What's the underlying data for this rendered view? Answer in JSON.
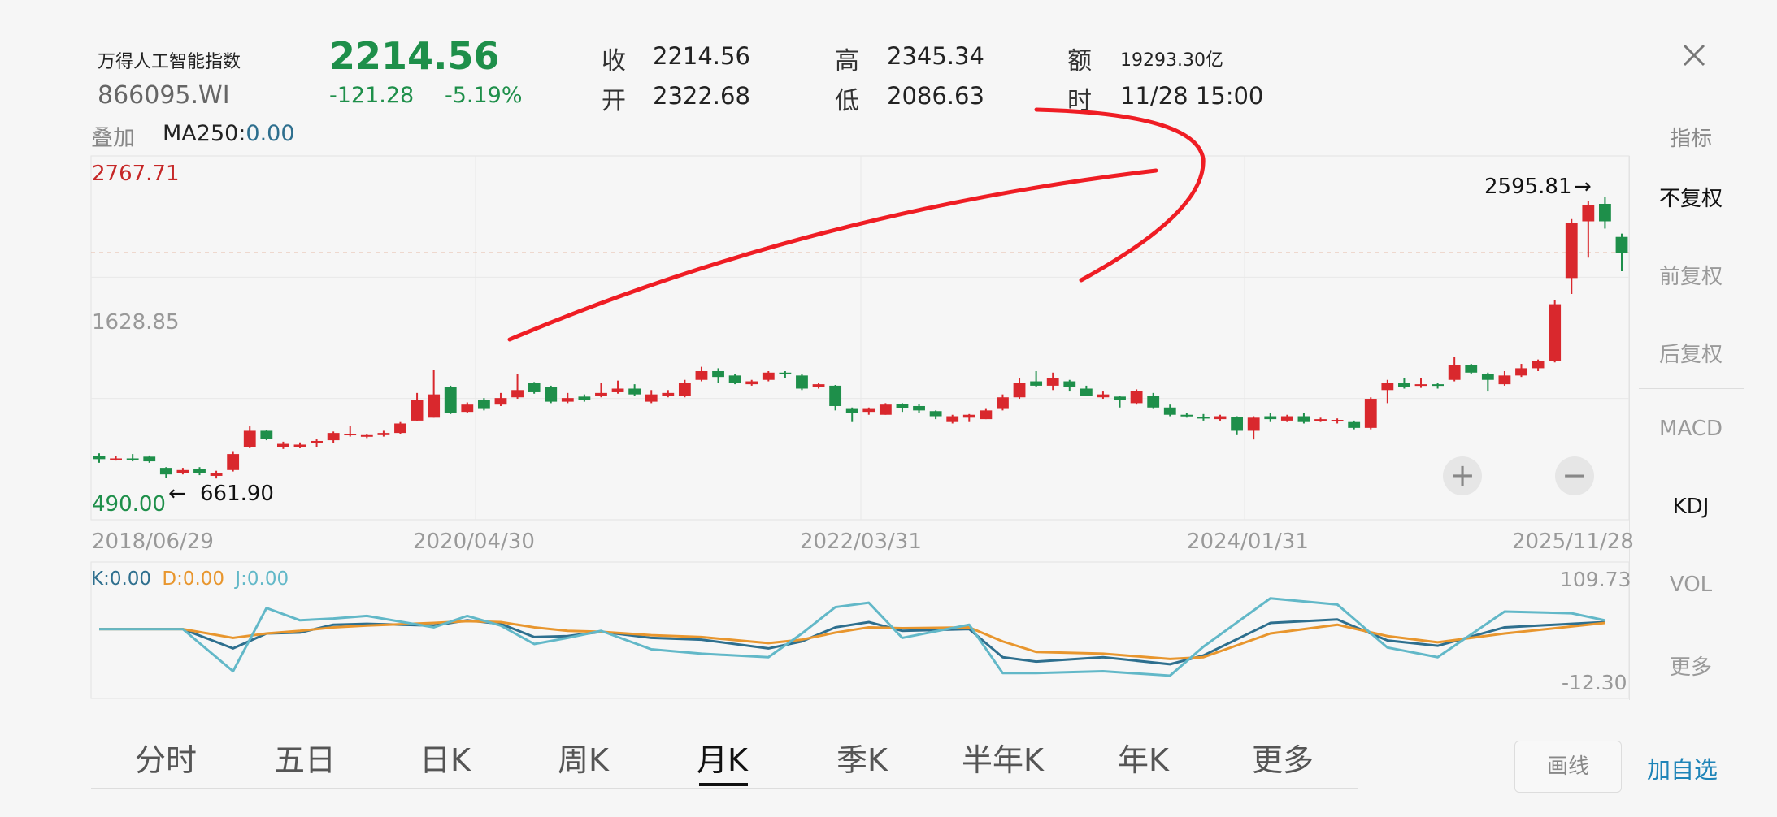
{
  "header": {
    "name": "万得人工智能指数",
    "code": "866095.WI",
    "price": "2214.56",
    "change": "-121.28",
    "change_pct": "-5.19%",
    "close_label": "收",
    "close_value": "2214.56",
    "open_label": "开",
    "open_value": "2322.68",
    "high_label": "高",
    "high_value": "2345.34",
    "low_label": "低",
    "low_value": "2086.63",
    "amount_label": "额",
    "amount_value": "19293.30亿",
    "time_label": "时",
    "time_value": "11/28 15:00",
    "close_icon": "close-icon"
  },
  "overlay": {
    "label": "叠加",
    "ma_label": "MA250:",
    "ma_value": "0.00"
  },
  "sidebar": {
    "title": "指标",
    "items": [
      "不复权",
      "前复权",
      "后复权",
      "MACD",
      "KDJ",
      "VOL",
      "更多"
    ]
  },
  "tabs": [
    "分时",
    "五日",
    "日K",
    "周K",
    "月K",
    "季K",
    "半年K",
    "年K",
    "更多"
  ],
  "active_tab": "月K",
  "bottom_buttons": {
    "draw": "画线",
    "add_watch": "加自选"
  },
  "colors": {
    "up": "#d9282d",
    "down": "#1e8f4a",
    "k": "#2e6f8e",
    "d": "#e8962e",
    "j": "#62b8c8"
  },
  "chart_data": [
    {
      "type": "candlestick",
      "title": "月K",
      "ylim": [
        490.0,
        2767.71
      ],
      "y_labels": {
        "top": "2767.71",
        "mid": "1628.85",
        "bottom": "490.00"
      },
      "x_labels": [
        "2018/06/29",
        "2020/04/30",
        "2022/03/31",
        "2024/01/31",
        "2025/11/28"
      ],
      "annotations": {
        "max_label": "2595.81",
        "min_label": "661.90",
        "max_arrow": "→",
        "min_arrow": "←"
      },
      "candles": [
        {
          "o": 815,
          "c": 795,
          "h": 835,
          "l": 770
        },
        {
          "o": 795,
          "c": 800,
          "h": 815,
          "l": 785
        },
        {
          "o": 800,
          "c": 798,
          "h": 830,
          "l": 780
        },
        {
          "o": 812,
          "c": 780,
          "h": 820,
          "l": 770
        },
        {
          "o": 735,
          "c": 690,
          "h": 740,
          "l": 665
        },
        {
          "o": 700,
          "c": 720,
          "h": 735,
          "l": 690
        },
        {
          "o": 730,
          "c": 700,
          "h": 740,
          "l": 685
        },
        {
          "o": 680,
          "c": 700,
          "h": 715,
          "l": 662
        },
        {
          "o": 720,
          "c": 830,
          "h": 850,
          "l": 710
        },
        {
          "o": 880,
          "c": 990,
          "h": 1020,
          "l": 870
        },
        {
          "o": 990,
          "c": 935,
          "h": 995,
          "l": 925
        },
        {
          "o": 880,
          "c": 900,
          "h": 915,
          "l": 865
        },
        {
          "o": 880,
          "c": 895,
          "h": 910,
          "l": 870
        },
        {
          "o": 905,
          "c": 920,
          "h": 935,
          "l": 880
        },
        {
          "o": 925,
          "c": 975,
          "h": 985,
          "l": 905
        },
        {
          "o": 960,
          "c": 970,
          "h": 1025,
          "l": 950
        },
        {
          "o": 950,
          "c": 960,
          "h": 970,
          "l": 940
        },
        {
          "o": 960,
          "c": 975,
          "h": 990,
          "l": 950
        },
        {
          "o": 975,
          "c": 1040,
          "h": 1050,
          "l": 965
        },
        {
          "o": 1060,
          "c": 1200,
          "h": 1250,
          "l": 1055
        },
        {
          "o": 1080,
          "c": 1240,
          "h": 1410,
          "l": 1080
        },
        {
          "o": 1290,
          "c": 1110,
          "h": 1300,
          "l": 1105
        },
        {
          "o": 1120,
          "c": 1170,
          "h": 1185,
          "l": 1110
        },
        {
          "o": 1200,
          "c": 1140,
          "h": 1215,
          "l": 1130
        },
        {
          "o": 1170,
          "c": 1215,
          "h": 1250,
          "l": 1160
        },
        {
          "o": 1220,
          "c": 1270,
          "h": 1380,
          "l": 1210
        },
        {
          "o": 1320,
          "c": 1255,
          "h": 1325,
          "l": 1245
        },
        {
          "o": 1290,
          "c": 1190,
          "h": 1300,
          "l": 1180
        },
        {
          "o": 1190,
          "c": 1215,
          "h": 1250,
          "l": 1180
        },
        {
          "o": 1225,
          "c": 1200,
          "h": 1240,
          "l": 1190
        },
        {
          "o": 1230,
          "c": 1250,
          "h": 1320,
          "l": 1220
        },
        {
          "o": 1255,
          "c": 1280,
          "h": 1335,
          "l": 1245
        },
        {
          "o": 1280,
          "c": 1240,
          "h": 1310,
          "l": 1230
        },
        {
          "o": 1190,
          "c": 1240,
          "h": 1270,
          "l": 1180
        },
        {
          "o": 1230,
          "c": 1250,
          "h": 1270,
          "l": 1220
        },
        {
          "o": 1230,
          "c": 1320,
          "h": 1340,
          "l": 1220
        },
        {
          "o": 1340,
          "c": 1400,
          "h": 1430,
          "l": 1330
        },
        {
          "o": 1400,
          "c": 1360,
          "h": 1420,
          "l": 1320
        },
        {
          "o": 1370,
          "c": 1320,
          "h": 1380,
          "l": 1310
        },
        {
          "o": 1310,
          "c": 1330,
          "h": 1340,
          "l": 1300
        },
        {
          "o": 1340,
          "c": 1390,
          "h": 1400,
          "l": 1330
        },
        {
          "o": 1390,
          "c": 1380,
          "h": 1400,
          "l": 1350
        },
        {
          "o": 1370,
          "c": 1280,
          "h": 1380,
          "l": 1270
        },
        {
          "o": 1290,
          "c": 1310,
          "h": 1320,
          "l": 1280
        },
        {
          "o": 1300,
          "c": 1160,
          "h": 1305,
          "l": 1130
        },
        {
          "o": 1140,
          "c": 1110,
          "h": 1150,
          "l": 1050
        },
        {
          "o": 1120,
          "c": 1140,
          "h": 1150,
          "l": 1100
        },
        {
          "o": 1100,
          "c": 1170,
          "h": 1180,
          "l": 1100
        },
        {
          "o": 1175,
          "c": 1145,
          "h": 1180,
          "l": 1120
        },
        {
          "o": 1160,
          "c": 1130,
          "h": 1175,
          "l": 1110
        },
        {
          "o": 1125,
          "c": 1090,
          "h": 1130,
          "l": 1070
        },
        {
          "o": 1050,
          "c": 1090,
          "h": 1100,
          "l": 1040
        },
        {
          "o": 1080,
          "c": 1100,
          "h": 1105,
          "l": 1050
        },
        {
          "o": 1070,
          "c": 1130,
          "h": 1140,
          "l": 1070
        },
        {
          "o": 1140,
          "c": 1220,
          "h": 1240,
          "l": 1130
        },
        {
          "o": 1220,
          "c": 1320,
          "h": 1350,
          "l": 1210
        },
        {
          "o": 1330,
          "c": 1300,
          "h": 1400,
          "l": 1290
        },
        {
          "o": 1300,
          "c": 1350,
          "h": 1390,
          "l": 1270
        },
        {
          "o": 1330,
          "c": 1290,
          "h": 1340,
          "l": 1260
        },
        {
          "o": 1280,
          "c": 1230,
          "h": 1300,
          "l": 1230
        },
        {
          "o": 1220,
          "c": 1240,
          "h": 1260,
          "l": 1210
        },
        {
          "o": 1225,
          "c": 1200,
          "h": 1230,
          "l": 1150
        },
        {
          "o": 1180,
          "c": 1265,
          "h": 1275,
          "l": 1170
        },
        {
          "o": 1230,
          "c": 1150,
          "h": 1250,
          "l": 1140
        },
        {
          "o": 1150,
          "c": 1100,
          "h": 1170,
          "l": 1090
        },
        {
          "o": 1100,
          "c": 1090,
          "h": 1110,
          "l": 1080
        },
        {
          "o": 1085,
          "c": 1080,
          "h": 1105,
          "l": 1060
        },
        {
          "o": 1070,
          "c": 1090,
          "h": 1100,
          "l": 1060
        },
        {
          "o": 1085,
          "c": 990,
          "h": 1090,
          "l": 960
        },
        {
          "o": 990,
          "c": 1080,
          "h": 1090,
          "l": 930
        },
        {
          "o": 1090,
          "c": 1070,
          "h": 1110,
          "l": 1050
        },
        {
          "o": 1060,
          "c": 1090,
          "h": 1100,
          "l": 1050
        },
        {
          "o": 1090,
          "c": 1050,
          "h": 1110,
          "l": 1040
        },
        {
          "o": 1060,
          "c": 1070,
          "h": 1080,
          "l": 1050
        },
        {
          "o": 1060,
          "c": 1065,
          "h": 1075,
          "l": 1040
        },
        {
          "o": 1050,
          "c": 1010,
          "h": 1060,
          "l": 1000
        },
        {
          "o": 1010,
          "c": 1210,
          "h": 1220,
          "l": 1000
        },
        {
          "o": 1270,
          "c": 1320,
          "h": 1340,
          "l": 1180
        },
        {
          "o": 1320,
          "c": 1290,
          "h": 1350,
          "l": 1280
        },
        {
          "o": 1300,
          "c": 1310,
          "h": 1350,
          "l": 1285
        },
        {
          "o": 1310,
          "c": 1300,
          "h": 1320,
          "l": 1280
        },
        {
          "o": 1340,
          "c": 1440,
          "h": 1500,
          "l": 1330
        },
        {
          "o": 1440,
          "c": 1390,
          "h": 1450,
          "l": 1380
        },
        {
          "o": 1380,
          "c": 1340,
          "h": 1390,
          "l": 1260
        },
        {
          "o": 1310,
          "c": 1370,
          "h": 1400,
          "l": 1300
        },
        {
          "o": 1370,
          "c": 1420,
          "h": 1450,
          "l": 1360
        },
        {
          "o": 1420,
          "c": 1470,
          "h": 1480,
          "l": 1400
        },
        {
          "o": 1470,
          "c": 1860,
          "h": 1890,
          "l": 1460
        },
        {
          "o": 2040,
          "c": 2420,
          "h": 2445,
          "l": 1930
        },
        {
          "o": 2430,
          "c": 2540,
          "h": 2570,
          "l": 2180
        },
        {
          "o": 2550,
          "c": 2430,
          "h": 2595.81,
          "l": 2380
        },
        {
          "o": 2322.68,
          "c": 2214.56,
          "h": 2345.34,
          "l": 2086.63
        }
      ]
    },
    {
      "type": "line",
      "title": "KDJ",
      "ylim": [
        -12.3,
        109.73
      ],
      "y_labels": {
        "top": "109.73",
        "bottom": "-12.30"
      },
      "legend": [
        {
          "label": "K:",
          "value": "0.00"
        },
        {
          "label": "D:",
          "value": "0.00"
        },
        {
          "label": "J:",
          "value": "0.00"
        }
      ],
      "x_index": [
        0,
        5,
        8,
        10,
        12,
        14,
        16,
        20,
        22,
        24,
        26,
        28,
        30,
        33,
        36,
        40,
        42,
        44,
        46,
        48,
        52,
        54,
        56,
        60,
        64,
        66,
        70,
        74,
        77,
        80,
        84,
        88,
        90
      ],
      "series": [
        {
          "name": "K",
          "values": [
            50,
            50,
            28,
            45,
            46,
            55,
            56,
            54,
            60,
            56,
            41,
            42,
            47,
            40,
            38,
            28,
            36,
            52,
            58,
            48,
            50,
            18,
            13,
            18,
            10,
            20,
            57,
            61,
            37,
            31,
            52,
            56,
            58
          ]
        },
        {
          "name": "D",
          "values": [
            50,
            50,
            40,
            45,
            48,
            52,
            54,
            57,
            59,
            58,
            52,
            48,
            47,
            43,
            41,
            34,
            38,
            46,
            52,
            51,
            52,
            36,
            24,
            22,
            16,
            18,
            45,
            55,
            42,
            35,
            45,
            53,
            57
          ]
        },
        {
          "name": "J",
          "values": [
            50,
            50,
            2,
            74,
            60,
            62,
            65,
            52,
            65,
            54,
            33,
            40,
            48,
            27,
            22,
            18,
            45,
            75,
            80,
            40,
            55,
            0,
            0,
            2,
            -3,
            30,
            85,
            78,
            29,
            18,
            70,
            68,
            60
          ]
        }
      ]
    }
  ]
}
